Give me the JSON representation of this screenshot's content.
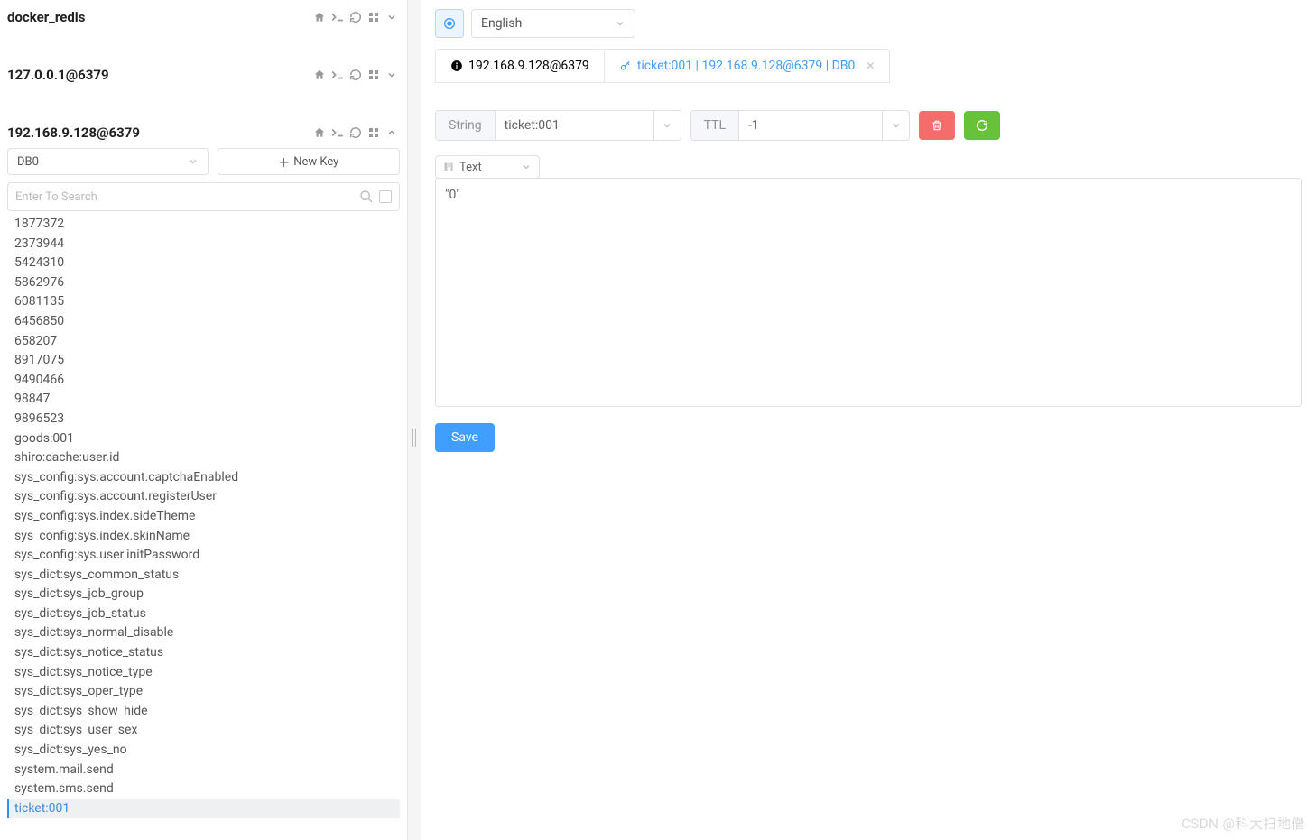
{
  "connections": [
    {
      "name": "docker_redis",
      "expanded": false
    },
    {
      "name": "127.0.0.1@6379",
      "expanded": false
    },
    {
      "name": "192.168.9.128@6379",
      "expanded": true
    }
  ],
  "sidebar": {
    "db_select": "DB0",
    "newkey_label": "New Key",
    "search_placeholder": "Enter To Search",
    "keys": [
      "1877372",
      "2373944",
      "5424310",
      "5862976",
      "6081135",
      "6456850",
      "658207",
      "8917075",
      "9490466",
      "98847",
      "9896523",
      "goods:001",
      "shiro:cache:user.id",
      "sys_config:sys.account.captchaEnabled",
      "sys_config:sys.account.registerUser",
      "sys_config:sys.index.sideTheme",
      "sys_config:sys.index.skinName",
      "sys_config:sys.user.initPassword",
      "sys_dict:sys_common_status",
      "sys_dict:sys_job_group",
      "sys_dict:sys_job_status",
      "sys_dict:sys_normal_disable",
      "sys_dict:sys_notice_status",
      "sys_dict:sys_notice_type",
      "sys_dict:sys_oper_type",
      "sys_dict:sys_show_hide",
      "sys_dict:sys_user_sex",
      "sys_dict:sys_yes_no",
      "system.mail.send",
      "system.sms.send",
      "ticket:001"
    ],
    "selected_key": "ticket:001"
  },
  "topbar": {
    "language": "English"
  },
  "tabs": [
    {
      "label": "192.168.9.128@6379",
      "active": false,
      "icon": "info"
    },
    {
      "label": "ticket:001 | 192.168.9.128@6379 | DB0",
      "active": true,
      "icon": "key",
      "closable": true
    }
  ],
  "detail": {
    "type_label": "String",
    "key_name": "ticket:001",
    "ttl_label": "TTL",
    "ttl_value": "-1",
    "format_label": "Text",
    "value": "\"0\"",
    "save_label": "Save"
  },
  "watermark": "CSDN @科大扫地僧"
}
